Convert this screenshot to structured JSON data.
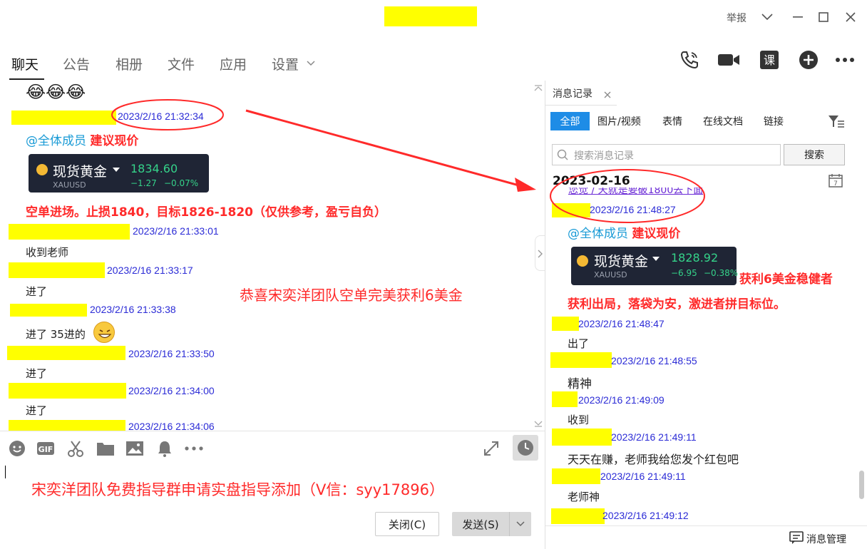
{
  "window": {
    "report_label": "举报",
    "title_redacted": true
  },
  "nav": {
    "tabs": [
      "聊天",
      "公告",
      "相册",
      "文件",
      "应用",
      "设置"
    ],
    "active": "聊天"
  },
  "chat": {
    "emojis": "😂😂😂",
    "messages": [
      {
        "time": "2023/2/16 21:32:34"
      },
      {
        "time": "2023/2/16 21:33:01",
        "text": "收到老师"
      },
      {
        "time": "2023/2/16 21:33:17",
        "text": "进了"
      },
      {
        "time": "2023/2/16 21:33:38",
        "text": "进了 35进的"
      },
      {
        "time": "2023/2/16 21:33:50",
        "text": "进了"
      },
      {
        "time": "2023/2/16 21:34:00",
        "text": "进了"
      },
      {
        "time": "2023/2/16 21:34:06"
      }
    ],
    "mention": "@全体成员",
    "suggest": "建议现价",
    "signal": "空单进场。止损1840，目标1826-1820（仅供参考，盈亏自负）",
    "gold_card": {
      "name": "现货黄金",
      "symbol": "XAUUSD",
      "price": "1834.60",
      "change": "−1.27",
      "change_pct": "−0.07%"
    },
    "overlay_congrats": "恭喜宋奕洋团队空单完美获利6美金"
  },
  "composer": {
    "overlay_text": "宋奕洋团队免费指导群申请实盘指导添加（V信：syy17896）",
    "close_label": "关闭(C)",
    "send_label": "发送(S)"
  },
  "history": {
    "tab_label": "消息记录",
    "filters": [
      "全部",
      "图片/视频",
      "表情",
      "在线文档",
      "链接"
    ],
    "active_filter": "全部",
    "search_placeholder": "搜索消息记录",
    "search_button": "搜索",
    "date": "2023-02-16",
    "cut_text": "您觉 / 天就是要破1800去下面",
    "messages": [
      {
        "time": "2023/2/16 21:48:27"
      },
      {
        "time": "2023/2/16 21:48:47",
        "text": "出了"
      },
      {
        "time": "2023/2/16 21:48:55",
        "text": "精神"
      },
      {
        "time": "2023/2/16 21:49:09",
        "text": "收到"
      },
      {
        "time": "2023/2/16 21:49:11",
        "text": "天天在赚，老师我给您发个红包吧"
      },
      {
        "time": "2023/2/16 21:49:11",
        "text": "老师神"
      },
      {
        "time": "2023/2/16 21:49:12"
      }
    ],
    "mention": "@全体成员",
    "suggest": "建议现价",
    "gold_card": {
      "name": "现货黄金",
      "symbol": "XAUUSD",
      "price": "1828.92",
      "change": "−6.95",
      "change_pct": "−0.38%"
    },
    "profit_note1": "获利6美金稳健者",
    "profit_note2": "获利出局，落袋为安，激进者拼目标位。",
    "manage_label": "消息管理"
  },
  "colors": {
    "accent": "#1e8ce6",
    "redact": "#ffff00",
    "annot_red": "#ff2a2a",
    "timestamp": "#2b2bd6",
    "mention": "#1a9bd6"
  }
}
